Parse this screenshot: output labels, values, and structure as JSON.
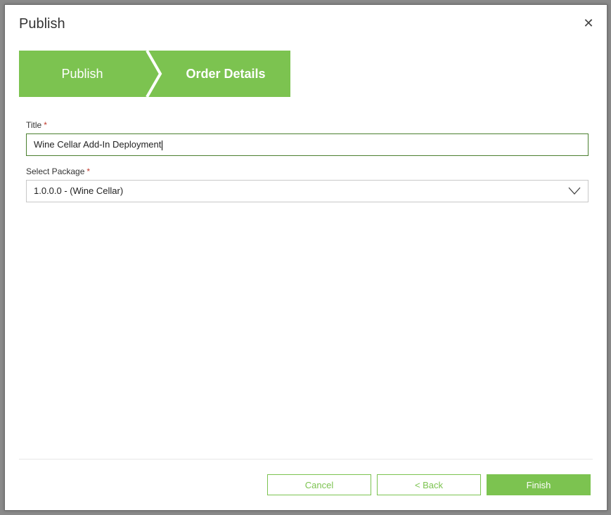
{
  "dialog": {
    "title": "Publish"
  },
  "wizard": {
    "steps": [
      {
        "label": "Publish"
      },
      {
        "label": "Order Details"
      }
    ],
    "accent": "#7cc350"
  },
  "form": {
    "title_label": "Title",
    "title_value": "Wine Cellar Add-In Deployment",
    "package_label": "Select Package",
    "package_value": "1.0.0.0 - (Wine Cellar)",
    "required_mark": "*"
  },
  "footer": {
    "cancel": "Cancel",
    "back": "< Back",
    "finish": "Finish"
  },
  "icons": {
    "close": "close-icon",
    "chevron": "chevron-down-icon"
  }
}
